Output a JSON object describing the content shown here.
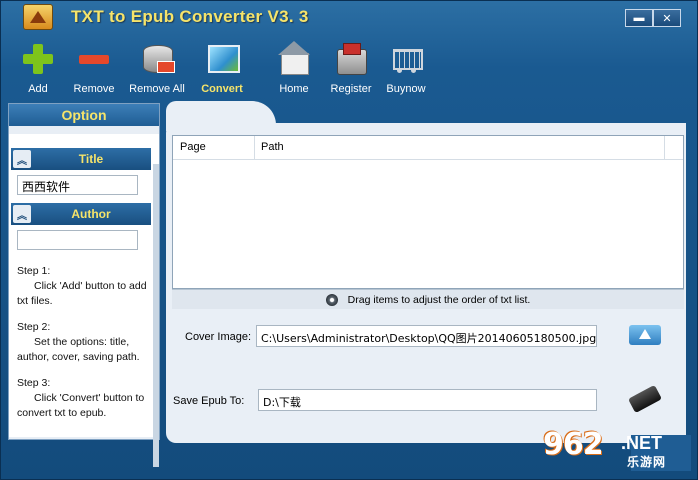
{
  "window": {
    "title": "TXT to Epub Converter V3. 3",
    "minimize_label": "▬",
    "close_label": "✕"
  },
  "toolbar": {
    "items": [
      {
        "label": "Add",
        "icon": "add-icon"
      },
      {
        "label": "Remove",
        "icon": "remove-icon"
      },
      {
        "label": "Remove All",
        "icon": "remove-all-icon"
      },
      {
        "label": "Convert",
        "icon": "convert-icon"
      },
      {
        "label": "Home",
        "icon": "home-icon"
      },
      {
        "label": "Register",
        "icon": "register-icon"
      },
      {
        "label": "Buynow",
        "icon": "cart-icon"
      }
    ]
  },
  "left": {
    "header": "Option",
    "title_section": "Title",
    "title_value": "西西软件",
    "author_section": "Author",
    "author_value": "",
    "toggle_glyph": "︽",
    "steps": [
      {
        "label": "Step 1:",
        "desc": "Click 'Add' button to add txt files."
      },
      {
        "label": "Step 2:",
        "desc": "Set the options: title, author, cover, saving path."
      },
      {
        "label": "Step 3:",
        "desc": "Click 'Convert' button to convert txt to epub."
      }
    ]
  },
  "main": {
    "columns": [
      "Page",
      "Path"
    ],
    "drag_hint": "Drag items to  adjust the order of txt list.",
    "cover_label": "Cover Image:",
    "cover_value": "C:\\Users\\Administrator\\Desktop\\QQ图片20140605180500.jpg",
    "save_label": "Save  Epub  To:",
    "save_value": "D:\\下载"
  },
  "watermark": {
    "logo": "962",
    "net": ".NET",
    "sub": "乐游网"
  },
  "colors": {
    "accent": "#f6e46a",
    "frame": "#1a5a91"
  }
}
